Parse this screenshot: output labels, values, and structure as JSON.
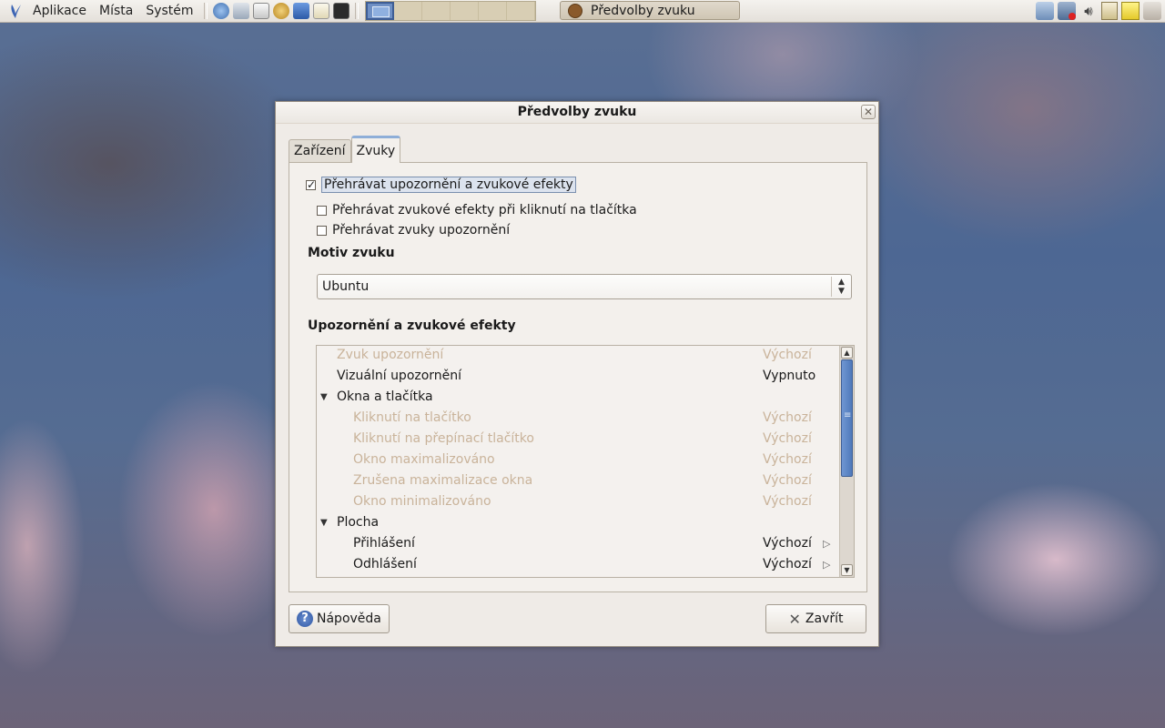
{
  "top_panel": {
    "menus": [
      "Aplikace",
      "Místa",
      "Systém"
    ],
    "taskbar_window_title": "Předvolby zvuku"
  },
  "dialog": {
    "title": "Předvolby zvuku",
    "tabs": [
      {
        "label": "Zařízení",
        "active": false
      },
      {
        "label": "Zvuky",
        "active": true
      }
    ],
    "checkboxes": [
      {
        "label": "Přehrávat upozornění a zvukové efekty",
        "checked": true
      },
      {
        "label": "Přehrávat zvukové efekty při kliknutí na tlačítka",
        "checked": false
      },
      {
        "label": "Přehrávat zvuky upozornění",
        "checked": false
      }
    ],
    "theme_section_title": "Motiv zvuku",
    "theme_selected": "Ubuntu",
    "events_section_title": "Upozornění a zvukové efekty",
    "events": [
      {
        "name": "Zvuk upozornění",
        "value": "Výchozí",
        "level": 0,
        "disabled": true
      },
      {
        "name": "Vizuální upozornění",
        "value": "Vypnuto",
        "level": 0,
        "disabled": false
      },
      {
        "name": "Okna a tlačítka",
        "value": "",
        "level": 0,
        "group": true
      },
      {
        "name": "Kliknutí na tlačítko",
        "value": "Výchozí",
        "level": 1,
        "disabled": true
      },
      {
        "name": "Kliknutí na přepínací tlačítko",
        "value": "Výchozí",
        "level": 1,
        "disabled": true
      },
      {
        "name": "Okno maximalizováno",
        "value": "Výchozí",
        "level": 1,
        "disabled": true
      },
      {
        "name": "Zrušena maximalizace okna",
        "value": "Výchozí",
        "level": 1,
        "disabled": true
      },
      {
        "name": "Okno minimalizováno",
        "value": "Výchozí",
        "level": 1,
        "disabled": true
      },
      {
        "name": "Plocha",
        "value": "",
        "level": 0,
        "group": true
      },
      {
        "name": "Přihlášení",
        "value": "Výchozí",
        "level": 1,
        "disabled": false,
        "play": true
      },
      {
        "name": "Odhlášení",
        "value": "Výchozí",
        "level": 1,
        "disabled": false,
        "play": true
      }
    ],
    "help_button": "Nápověda",
    "close_button": "Zavřít"
  },
  "icons": {
    "ubuntu": "ubuntu-logo-icon",
    "close": "close-icon",
    "help": "help-icon",
    "expander": "triangle-down-icon",
    "play": "play-icon"
  }
}
